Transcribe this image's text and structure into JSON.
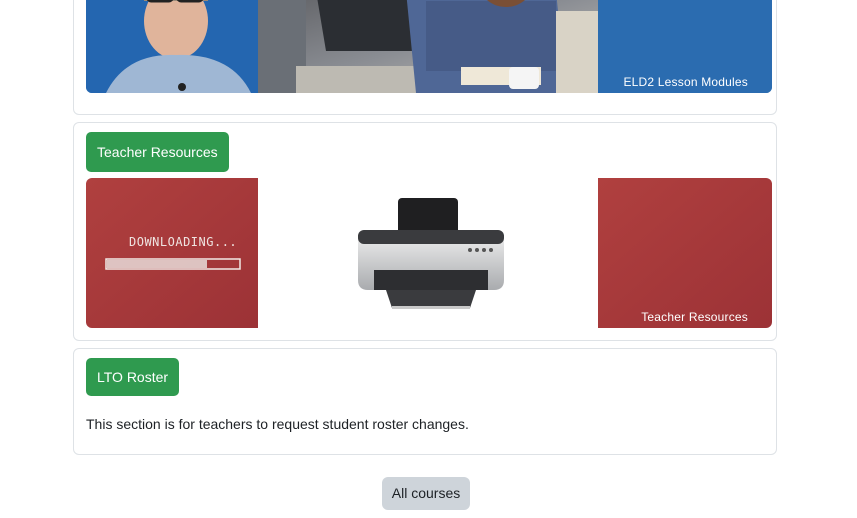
{
  "sections": {
    "eld": {
      "banner_caption": "ELD2 Lesson Modules"
    },
    "teacher_resources": {
      "button_label": "Teacher Resources",
      "banner_text": "DOWNLOADING...",
      "banner_caption": "Teacher Resources"
    },
    "lto_roster": {
      "button_label": "LTO Roster",
      "description": "This section is for teachers to request student roster changes."
    }
  },
  "footer": {
    "all_courses_label": "All courses"
  },
  "colors": {
    "accent_green": "#2f9a4f",
    "banner_blue": "#2b6cb0",
    "banner_red": "#a8383d",
    "muted_button": "#ced4da"
  }
}
